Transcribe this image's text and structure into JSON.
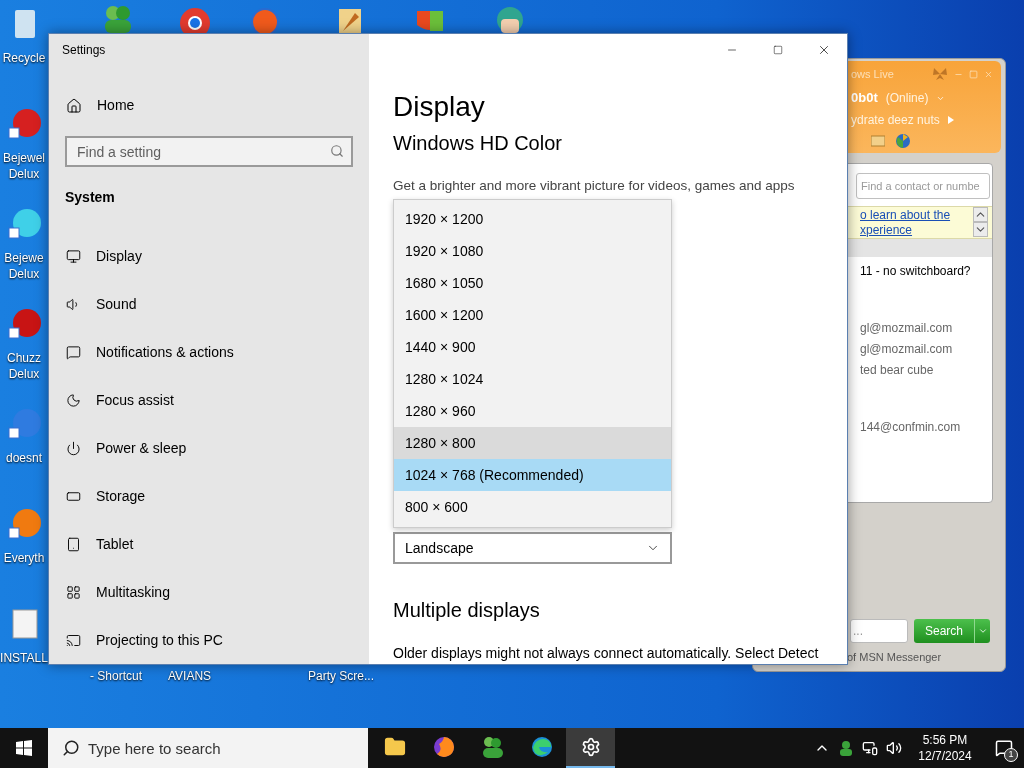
{
  "desktop": {
    "left_icons": [
      {
        "label_lines": [
          "Recycle"
        ]
      },
      {
        "label_lines": [
          "Bejewel",
          "Delux"
        ]
      },
      {
        "label_lines": [
          "Bejewe",
          "Delux"
        ]
      },
      {
        "label_lines": [
          "Chuzz",
          "Delux"
        ]
      },
      {
        "label_lines": [
          "doesnt"
        ]
      },
      {
        "label_lines": [
          "Everyth"
        ]
      },
      {
        "label_lines": [
          "INSTALL"
        ]
      }
    ],
    "bottom_labels": [
      "- Shortcut",
      "AVIANS",
      "Party Scre..."
    ]
  },
  "settings": {
    "title": "Settings",
    "home": "Home",
    "search_placeholder": "Find a setting",
    "section": "System",
    "nav_items": [
      "Display",
      "Sound",
      "Notifications & actions",
      "Focus assist",
      "Power & sleep",
      "Storage",
      "Tablet",
      "Multitasking",
      "Projecting to this PC"
    ],
    "heading": "Display",
    "subheading": "Windows HD Color",
    "description": "Get a brighter and more vibrant picture for videos, games and apps",
    "resolution_options": [
      {
        "label": "1920 × 1200",
        "selected": false,
        "hovered": false
      },
      {
        "label": "1920 × 1080",
        "selected": false,
        "hovered": false
      },
      {
        "label": "1680 × 1050",
        "selected": false,
        "hovered": false
      },
      {
        "label": "1600 × 1200",
        "selected": false,
        "hovered": false
      },
      {
        "label": "1440 × 900",
        "selected": false,
        "hovered": false
      },
      {
        "label": "1280 × 1024",
        "selected": false,
        "hovered": false
      },
      {
        "label": "1280 × 960",
        "selected": false,
        "hovered": false
      },
      {
        "label": "1280 × 800",
        "selected": false,
        "hovered": true
      },
      {
        "label": "1024 × 768 (Recommended)",
        "selected": true,
        "hovered": false
      },
      {
        "label": "800 × 600",
        "selected": false,
        "hovered": false
      }
    ],
    "orientation": "Landscape",
    "multiple_heading": "Multiple displays",
    "multiple_text": "Older displays might not always connect automatically. Select Detect"
  },
  "messenger": {
    "title": "ows Live",
    "name": "0b0t",
    "status": "(Online)",
    "personal_message": "ydrate deez nuts",
    "search_placeholder": "Find a contact or numbe",
    "banner_lines": [
      "o learn about the",
      "xperience"
    ],
    "groups": [
      {
        "header": "11 - no switchboard?"
      },
      {
        "contacts": [
          "gl@mozmail.com",
          "gl@mozmail.com",
          "ted bear cube"
        ]
      },
      {
        "contacts": [
          "144@confmin.com"
        ]
      }
    ],
    "search_value": "...",
    "search_button": "Search",
    "footer": "of MSN Messenger"
  },
  "taskbar": {
    "search_placeholder": "Type here to search",
    "apps": [
      {
        "active": false
      },
      {
        "active": false
      },
      {
        "active": false
      },
      {
        "active": false
      },
      {
        "active": true
      }
    ],
    "time": "5:56 PM",
    "date": "12/7/2024",
    "notification_count": "1"
  }
}
